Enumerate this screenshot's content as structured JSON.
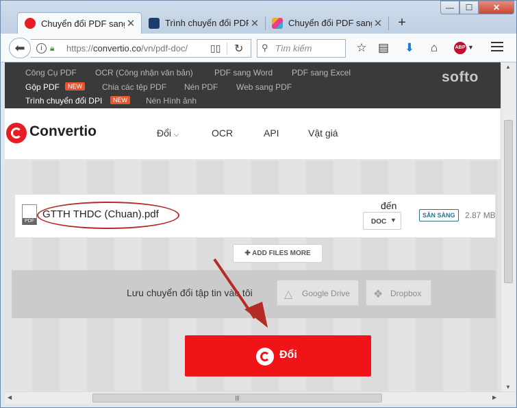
{
  "browser": {
    "tabs": [
      {
        "title": "Chuyển đổi PDF sang",
        "favicon_color": "#e81c24",
        "active": true
      },
      {
        "title": "Trình chuyển đổi PDF",
        "favicon_color": "#1f3c6e",
        "active": false
      },
      {
        "title": "Chuyển đổi PDF sang",
        "favicon_color": "#f5a623",
        "active": false
      }
    ],
    "new_tab_label": "+",
    "window_controls": {
      "minimize": "—",
      "maximize": "☐",
      "close": "✕"
    },
    "url": {
      "scheme": "https://",
      "host": "convertio.co",
      "path": "/vn/pdf-doc/"
    },
    "search_placeholder": "Tìm kiếm",
    "abp_label": "ABP"
  },
  "softo_nav": {
    "row1": [
      "Công Cụ PDF",
      "OCR (Công nhận văn bản)",
      "PDF sang Word",
      "PDF sang Excel"
    ],
    "row2": [
      {
        "label": "Gộp PDF",
        "badge": "NEW"
      },
      {
        "label": "Chia các tệp PDF"
      },
      {
        "label": "Nén PDF"
      },
      {
        "label": "Web sang PDF"
      }
    ],
    "row3": [
      {
        "label": "Trình chuyển đổi DPI",
        "badge": "NEW"
      },
      {
        "label": "Nén Hình ảnh"
      }
    ],
    "brand": "softo"
  },
  "header": {
    "logo": "Convertio",
    "menu": [
      "Đổi",
      "OCR",
      "API",
      "Vật giá"
    ]
  },
  "file": {
    "icon_label": "PDF",
    "name": "GTTH THDC (Chuan).pdf",
    "to_label": "đến",
    "format": "DOC",
    "status": "SẴN SÀNG",
    "size": "2.87 MB"
  },
  "add_more_label": "ADD FILES MORE",
  "save": {
    "text": "Lưu chuyển đổi tập tin vào tôi",
    "google_drive": "Google Drive",
    "dropbox": "Dropbox"
  },
  "convert_label": "Đổi",
  "colors": {
    "brand_red": "#f01418",
    "softo_bar": "#3a3a3a",
    "badge": "#e8542c",
    "annotation": "#b52b25"
  }
}
